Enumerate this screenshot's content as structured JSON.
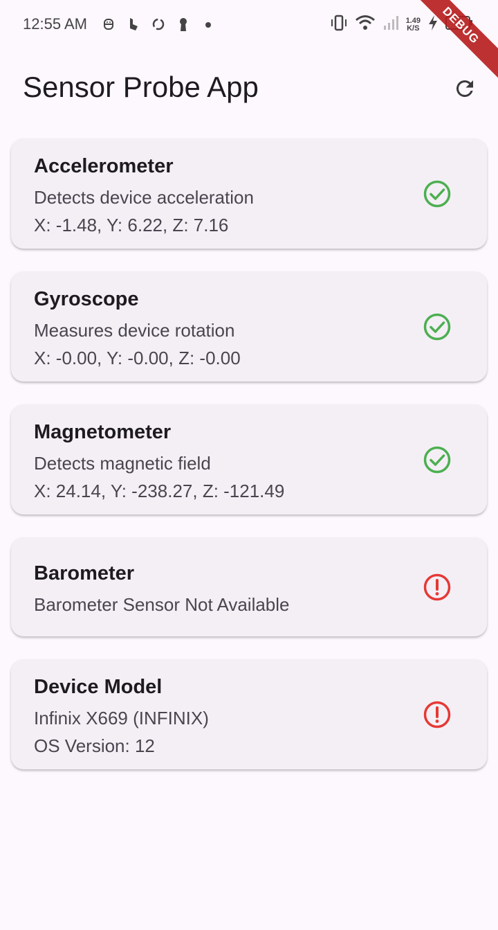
{
  "status_bar": {
    "time": "12:55 AM",
    "net_speed_value": "1.49",
    "net_speed_unit": "K/S",
    "left_icons": [
      "android-head-icon",
      "bing-icon",
      "sync-icon",
      "keyhole-icon",
      "dot-icon"
    ],
    "right_icons": [
      "vibrate-icon",
      "wifi-icon",
      "signal-icon",
      "charging-icon",
      "battery-icon"
    ]
  },
  "debug_banner": "DEBUG",
  "app_bar": {
    "title": "Sensor Probe App",
    "refresh_icon": "refresh-icon"
  },
  "sensors": [
    {
      "title": "Accelerometer",
      "description": "Detects device acceleration",
      "reading": "X: -1.48, Y: 6.22, Z: 7.16",
      "status": "available",
      "status_icon": "check-circle-icon"
    },
    {
      "title": "Gyroscope",
      "description": "Measures device rotation",
      "reading": "X: -0.00, Y: -0.00, Z: -0.00",
      "status": "available",
      "status_icon": "check-circle-icon"
    },
    {
      "title": "Magnetometer",
      "description": "Detects magnetic field",
      "reading": "X: 24.14, Y: -238.27, Z: -121.49",
      "status": "available",
      "status_icon": "check-circle-icon"
    },
    {
      "title": "Barometer",
      "description": "Barometer Sensor Not Available",
      "status": "unavailable",
      "status_icon": "error-circle-icon"
    },
    {
      "title": "Device Model",
      "description": "Infinix X669 (INFINIX)",
      "reading": "OS Version: 12",
      "status": "unavailable",
      "status_icon": "error-circle-icon"
    }
  ],
  "colors": {
    "background": "#fdf7fe",
    "card": "#f4eff5",
    "ok_green": "#4caf50",
    "error_red": "#e53935",
    "debug_banner": "#b71c1c"
  }
}
